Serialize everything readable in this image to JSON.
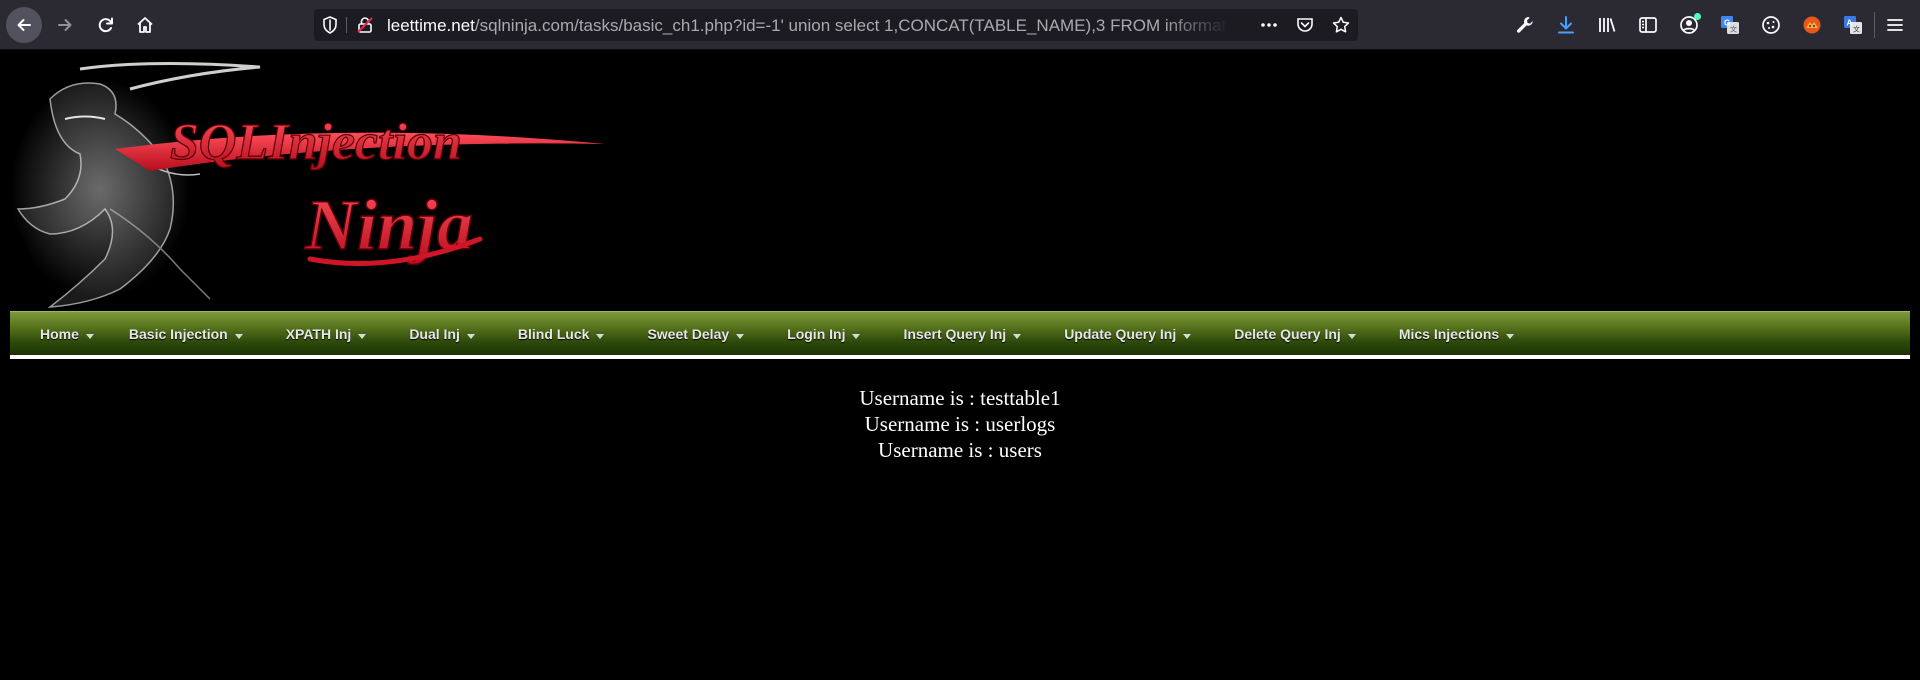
{
  "browser": {
    "url_domain": "leettime.net",
    "url_path": "/sqlninja.com/tasks/basic_ch1.php?id=-1' union select 1,CONCAT(TABLE_NAME),3 FROM informat",
    "toolbar_icons": [
      "back-icon",
      "forward-icon",
      "reload-icon",
      "home-icon",
      "shield-icon",
      "insecure-lock-icon",
      "more-actions-icon",
      "pocket-icon",
      "bookmark-star-icon",
      "tools-wrench-icon",
      "downloads-icon",
      "library-icon",
      "sidebar-icon",
      "account-icon",
      "translate-extension-icon",
      "cookie-extension-icon",
      "fox-extension-icon",
      "translate-alt-extension-icon",
      "menu-icon"
    ],
    "accent_color": "#45a1ff"
  },
  "banner": {
    "logo_line1": "SQLInjection",
    "logo_line2": "Ninja",
    "logo_color": "#e2182a"
  },
  "menu": {
    "items": [
      {
        "label": "Home"
      },
      {
        "label": "Basic Injection"
      },
      {
        "label": "XPATH Inj"
      },
      {
        "label": "Dual Inj"
      },
      {
        "label": "Blind Luck"
      },
      {
        "label": "Sweet Delay"
      },
      {
        "label": "Login Inj"
      },
      {
        "label": "Insert Query Inj"
      },
      {
        "label": "Update Query Inj"
      },
      {
        "label": "Delete Query Inj"
      },
      {
        "label": "Mics Injections"
      }
    ],
    "bar_color": "#56731c"
  },
  "results": {
    "lines": [
      "Username is : testtable1",
      "Username is : userlogs",
      "Username is : users"
    ]
  }
}
